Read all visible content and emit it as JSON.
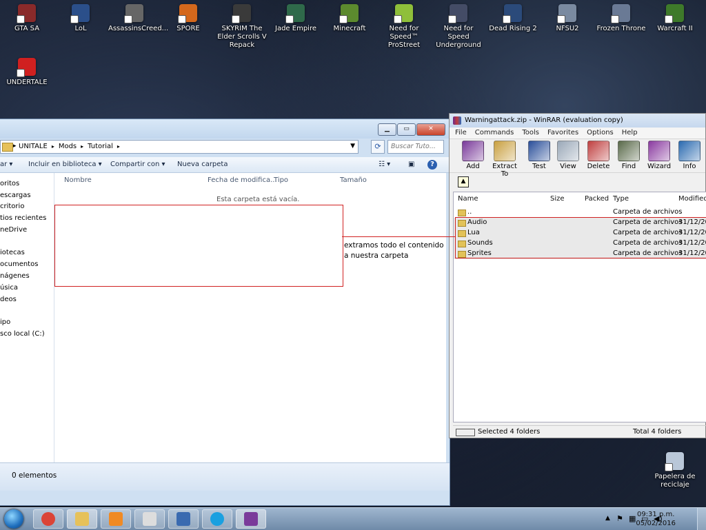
{
  "desktop_icons": [
    {
      "label": "GTA SA",
      "color": "#8a2a2a"
    },
    {
      "label": "LoL",
      "color": "#2b4f8a"
    },
    {
      "label": "AssassinsCreed...",
      "color": "#666666"
    },
    {
      "label": "SPORE",
      "color": "#d4681c"
    },
    {
      "label": "SKYRIM The Elder Scrolls V Repack",
      "color": "#3a3a3a"
    },
    {
      "label": "Jade Empire",
      "color": "#2f6a4a"
    },
    {
      "label": "Minecraft",
      "color": "#5c8a2e"
    },
    {
      "label": "Need for Speed™ ProStreet",
      "color": "#8fbf3a"
    },
    {
      "label": "Need for Speed Underground",
      "color": "#444c66"
    },
    {
      "label": "Dead Rising 2",
      "color": "#2b4a7a"
    },
    {
      "label": "NFSU2",
      "color": "#7a8aa0"
    },
    {
      "label": "Frozen Throne",
      "color": "#6a7a95"
    },
    {
      "label": "Warcraft II",
      "color": "#3e7a2a"
    },
    {
      "label": "UNDERTALE",
      "color": "#d02020"
    },
    {
      "label": "Papelera de reciclaje",
      "color": "#b9c7d8"
    }
  ],
  "explorer": {
    "breadcrumb": [
      "UNITALE",
      "Mods",
      "Tutorial"
    ],
    "search_placeholder": "Buscar Tuto...",
    "toolbar": {
      "organize": "ar ▾",
      "library": "Incluir en biblioteca ▾",
      "share": "Compartir con ▾",
      "new_folder": "Nueva carpeta"
    },
    "nav_items": [
      "oritos",
      "escargas",
      "critorio",
      "tios recientes",
      "neDrive",
      "iotecas",
      "ocumentos",
      "nágenes",
      "úsica",
      "deos",
      "ipo",
      "sco local (C:)"
    ],
    "columns": [
      "Nombre",
      "Fecha de modifica...",
      "Tipo",
      "Tamaño"
    ],
    "empty_message": "Esta carpeta está vacía.",
    "status": "0 elementos"
  },
  "annotation": {
    "line1": "extramos todo el contenido",
    "line2": "a nuestra carpeta"
  },
  "winrar": {
    "title": "Warningattack.zip - WinRAR (evaluation copy)",
    "menu": [
      "File",
      "Commands",
      "Tools",
      "Favorites",
      "Options",
      "Help"
    ],
    "toolbar": [
      {
        "label": "Add",
        "color": "#7a3a9a"
      },
      {
        "label": "Extract To",
        "color": "#c9a040"
      },
      {
        "label": "Test",
        "color": "#2a4f9a"
      },
      {
        "label": "View",
        "color": "#9aa8b8"
      },
      {
        "label": "Delete",
        "color": "#c04040"
      },
      {
        "label": "Find",
        "color": "#5a6a4a"
      },
      {
        "label": "Wizard",
        "color": "#8a3aa0"
      },
      {
        "label": "Info",
        "color": "#2a6ab0"
      }
    ],
    "columns": [
      "Name",
      "Size",
      "Packed",
      "Type",
      "Modified"
    ],
    "files": [
      {
        "name": "..",
        "type": "Carpeta de archivos",
        "modified": ""
      },
      {
        "name": "Audio",
        "type": "Carpeta de archivos",
        "modified": "31/12/201"
      },
      {
        "name": "Lua",
        "type": "Carpeta de archivos",
        "modified": "31/12/201"
      },
      {
        "name": "Sounds",
        "type": "Carpeta de archivos",
        "modified": "31/12/201"
      },
      {
        "name": "Sprites",
        "type": "Carpeta de archivos",
        "modified": "31/12/201"
      }
    ],
    "status_left": "Selected 4 folders",
    "status_right": "Total 4 folders"
  },
  "taskbar": {
    "apps": [
      {
        "name": "chrome",
        "color": "#db4437"
      },
      {
        "name": "explorer",
        "color": "#e6c15a"
      },
      {
        "name": "media-player",
        "color": "#f08a24"
      },
      {
        "name": "notepad",
        "color": "#dddddd"
      },
      {
        "name": "paint",
        "color": "#3a6ab0"
      },
      {
        "name": "skype",
        "color": "#1aa0e0"
      },
      {
        "name": "winrar",
        "color": "#7a3a9a"
      }
    ],
    "time": "09:31 p.m.",
    "date": "05/02/2016"
  }
}
